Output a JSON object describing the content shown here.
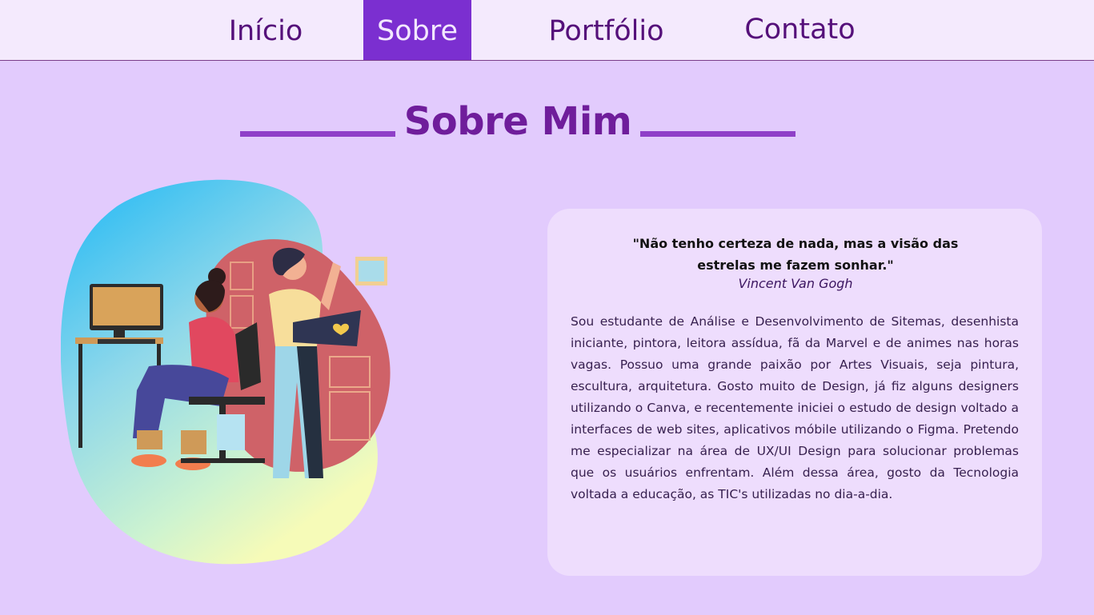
{
  "nav": {
    "items": [
      {
        "label": "Início"
      },
      {
        "label": "Sobre"
      },
      {
        "label": "Portfólio"
      },
      {
        "label": "Contato"
      }
    ]
  },
  "section": {
    "title": "Sobre Mim"
  },
  "about": {
    "quote": "\"Não tenho certeza de nada, mas a visão das estrelas me fazem sonhar.\"",
    "author": "Vincent Van Gogh",
    "bio": "Sou estudante de Análise e Desenvolvimento de Sitemas, desenhista iniciante, pintora, leitora assídua, fã da Marvel e de animes nas horas vagas. Possuo uma grande paixão por Artes Visuais, seja pintura, escultura, arquitetura. Gosto muito de Design, já fiz alguns designers utilizando o Canva, e recentemente iniciei o estudo de design voltado a interfaces de web sites, aplicativos móbile utilizando o Figma. Pretendo me especializar na área de UX/UI Design para solucionar problemas que os usuários enfrentam. Além dessa área, gosto da Tecnologia voltada a educação, as TIC's utilizadas no dia-a-dia."
  },
  "colors": {
    "background": "#e2cbfd",
    "navbar": "#f4eafd",
    "nav_active": "#7b2fd0",
    "title": "#6f1d9b",
    "card": "#eeddfd"
  },
  "illustration": {
    "icon": "designers-working-illustration"
  }
}
